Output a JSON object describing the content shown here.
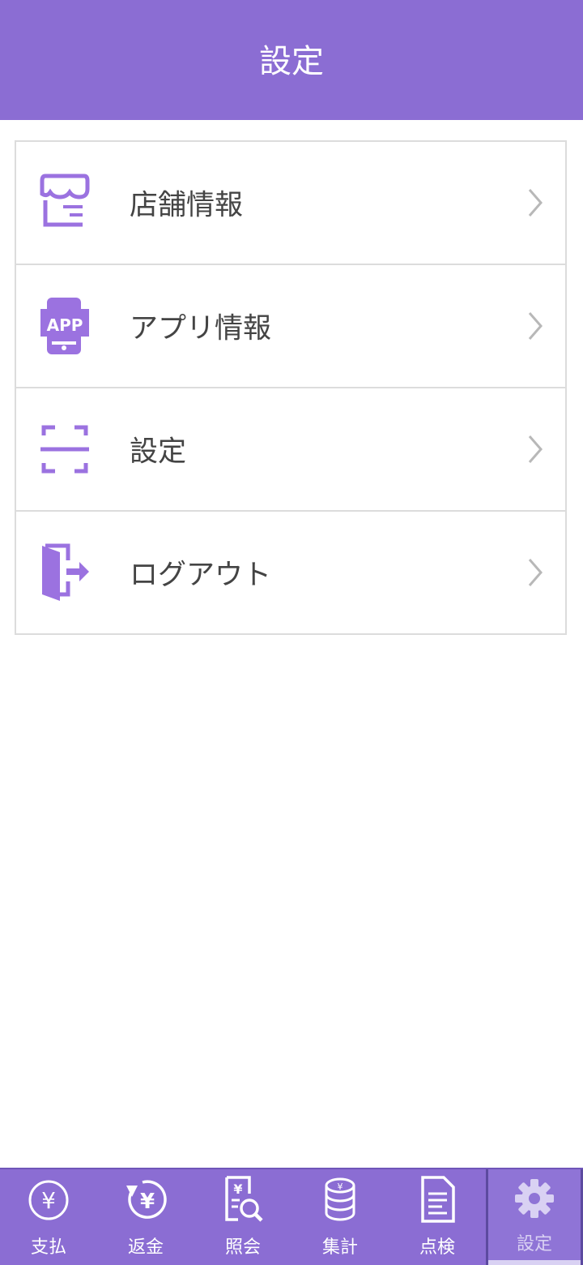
{
  "header": {
    "title": "設定"
  },
  "menu": {
    "items": [
      {
        "label": "店舗情報",
        "icon": "store-icon"
      },
      {
        "label": "アプリ情報",
        "icon": "app-phone-icon"
      },
      {
        "label": "設定",
        "icon": "scan-frame-icon"
      },
      {
        "label": "ログアウト",
        "icon": "logout-door-icon"
      }
    ],
    "app_icon_text": "APP"
  },
  "tabbar": {
    "tabs": [
      {
        "label": "支払",
        "icon": "yen-coin-icon",
        "symbol": "¥"
      },
      {
        "label": "返金",
        "icon": "yen-refund-icon",
        "symbol": "¥"
      },
      {
        "label": "照会",
        "icon": "receipt-search-icon",
        "symbol": "¥"
      },
      {
        "label": "集計",
        "icon": "coin-stack-icon",
        "symbol": "¥"
      },
      {
        "label": "点検",
        "icon": "document-icon"
      },
      {
        "label": "設定",
        "icon": "gear-icon",
        "active": true
      }
    ]
  },
  "colors": {
    "accent": "#8b6dd3",
    "icon": "#9b72e0",
    "text": "#444444",
    "divider": "#dcdcdc"
  }
}
